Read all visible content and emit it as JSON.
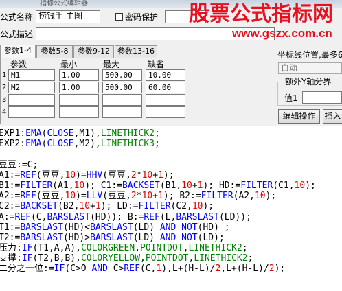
{
  "window": {
    "title": "指标公式编辑器"
  },
  "formula": {
    "name_label": "公式名称",
    "name_value": "捞钱手 主图",
    "password_label": "密码保护",
    "password_checked": false,
    "desc_label": "公式描述",
    "desc_value": ""
  },
  "tabs": [
    {
      "label": "参数1-4",
      "active": true
    },
    {
      "label": "参数5-8",
      "active": false
    },
    {
      "label": "参数9-12",
      "active": false
    },
    {
      "label": "参数13-16",
      "active": false
    }
  ],
  "params": {
    "headers": {
      "name": "参数",
      "min": "最小",
      "max": "最大",
      "default": "缺省"
    },
    "rows": [
      {
        "index": "1",
        "name": "M1",
        "min": "1.00",
        "max": "500.00",
        "default": "10.00"
      },
      {
        "index": "2",
        "name": "M2",
        "min": "1.00",
        "max": "500.00",
        "default": "60.00"
      },
      {
        "index": "3",
        "name": "",
        "min": "",
        "max": "",
        "default": ""
      },
      {
        "index": "4",
        "name": "",
        "min": "",
        "max": "",
        "default": ""
      }
    ]
  },
  "right_panel": {
    "axis_label": "坐标线位置,最多6",
    "axis_select": "自动",
    "extra_y_group": "额外Y轴分界",
    "value1_label": "值1",
    "value1": "",
    "edit_button": "编辑操作",
    "insert_button": "插入"
  },
  "editor": {
    "lines": [
      "EXP1:EMA(CLOSE,M1),LINETHICK2;",
      "EXP2:EMA(CLOSE,M2),LINETHICK3;",
      "",
      "豆豆:=C;",
      "A1:=REF(豆豆,10)=HHV(豆豆,2*10+1);",
      "B1:=FILTER(A1,10); C1:=BACKSET(B1,10+1); HD:=FILTER(C1,10);",
      "A2:=REF(豆豆,10)=LLV(豆豆,2*10+1); B2:=FILTER(A2,10);",
      "C2:=BACKSET(B2,10+1); LD:=FILTER(C2,10);",
      "A:=REF(C,BARSLAST(HD)); B:=REF(L,BARSLAST(LD));",
      "T1:=BARSLAST(HD)<BARSLAST(LD) AND NOT(HD) ;",
      "T2:=BARSLAST(HD)>BARSLAST(LD) AND NOT(LD);",
      "压力:IF(T1,A,A),COLORGREEN,POINTDOT,LINETHICK2;",
      "支撑:IF(T2,B,B),COLORYELLOW,POINTDOT,LINETHICK2;",
      "二分之一位:=IF(C>O AND C>REF(C,1),L+(H-L)/2,L+(H-L)/2);"
    ]
  },
  "watermark": {
    "title": "股票公式指标网",
    "url": "www.gszx.com.cn"
  },
  "colors": {
    "function": "#0000ff",
    "draw_attr": "#008000",
    "number": "#e00000",
    "code_text": "#000000",
    "watermark": "#e8101e"
  }
}
